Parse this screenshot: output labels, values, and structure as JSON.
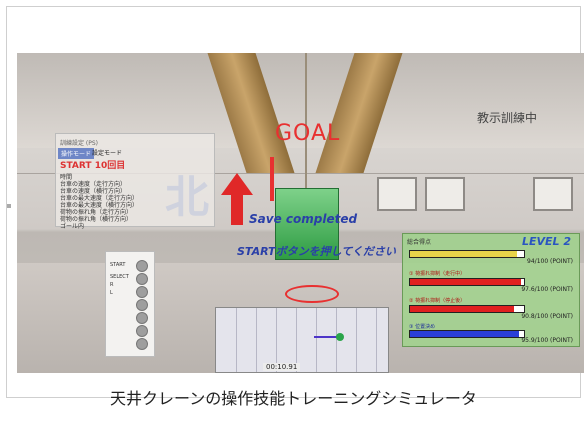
{
  "overlay": {
    "goal": "GOAL",
    "status": "教示訓練中",
    "north": "北",
    "saved": "Save completed",
    "prompt": "STARTボタンを押してください",
    "timer": "00:10.91"
  },
  "panel": {
    "header": "訓練設定 (PS)",
    "mode_active": "操作モード",
    "mode_other": "設定モード",
    "start_label": "START",
    "start_count": "10回目",
    "rows": [
      "時間",
      "台車の速度（走行方向）",
      "台車の速度（横行方向）",
      "台車の最大速度（走行方向）",
      "台車の最大速度（横行方向）",
      "荷物の振れ角（走行方向）",
      "荷物の振れ角（横行方向）",
      "ゴール内"
    ]
  },
  "buttons": {
    "labels": [
      "START",
      "SELECT",
      "R",
      "L"
    ]
  },
  "score": {
    "header": "総合得点",
    "level": "LEVEL 2",
    "total": "94/100 (POINT)",
    "items": [
      {
        "label": "① 荷振れ抑制（走行中）",
        "value": "97.6/100 (POINT)",
        "fraction": 0.976,
        "color": "#e02020"
      },
      {
        "label": "② 荷振れ抑制（停止後）",
        "value": "90.8/100 (POINT)",
        "fraction": 0.908,
        "color": "#e02020"
      },
      {
        "label": "③ 位置決め",
        "value": "95.9/100 (POINT)",
        "fraction": 0.959,
        "color": "#2a3fd8"
      }
    ],
    "total_fraction": 0.94,
    "total_color": "#e7d34a"
  },
  "caption": "天井クレーンの操作技能トレーニングシミュレータ"
}
